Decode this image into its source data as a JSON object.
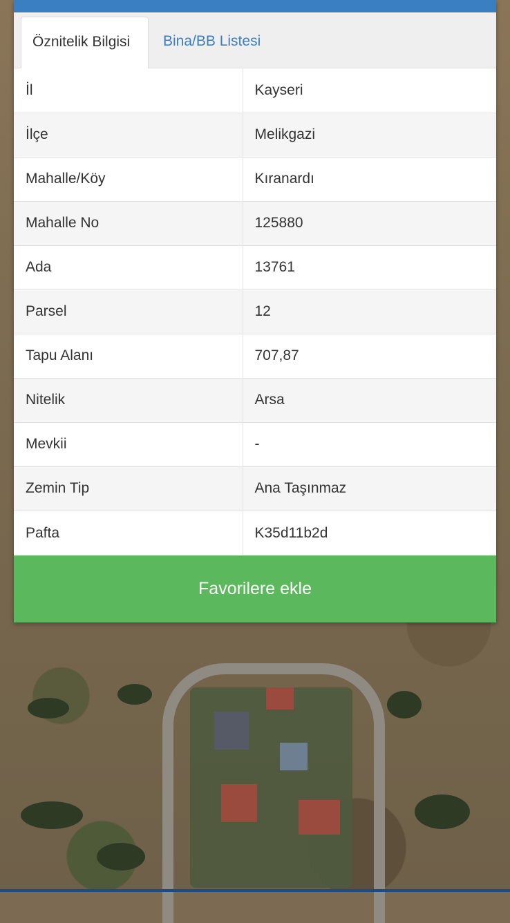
{
  "tabs": [
    {
      "label": "Öznitelik Bilgisi",
      "active": true
    },
    {
      "label": "Bina/BB Listesi",
      "active": false
    }
  ],
  "attributes": [
    {
      "key": "İl",
      "value": "Kayseri"
    },
    {
      "key": "İlçe",
      "value": "Melikgazi"
    },
    {
      "key": "Mahalle/Köy",
      "value": "Kıranardı"
    },
    {
      "key": "Mahalle No",
      "value": "125880"
    },
    {
      "key": "Ada",
      "value": "13761"
    },
    {
      "key": "Parsel",
      "value": "12"
    },
    {
      "key": "Tapu Alanı",
      "value": "707,87"
    },
    {
      "key": "Nitelik",
      "value": "Arsa"
    },
    {
      "key": "Mevkii",
      "value": "-"
    },
    {
      "key": "Zemin Tip",
      "value": "Ana Taşınmaz"
    },
    {
      "key": "Pafta",
      "value": "K35d11b2d"
    }
  ],
  "favorite_button": {
    "label": "Favorilere ekle"
  },
  "colors": {
    "header": "#3a7fc1",
    "button": "#5cb85c",
    "tab_link": "#3a7fc1"
  }
}
